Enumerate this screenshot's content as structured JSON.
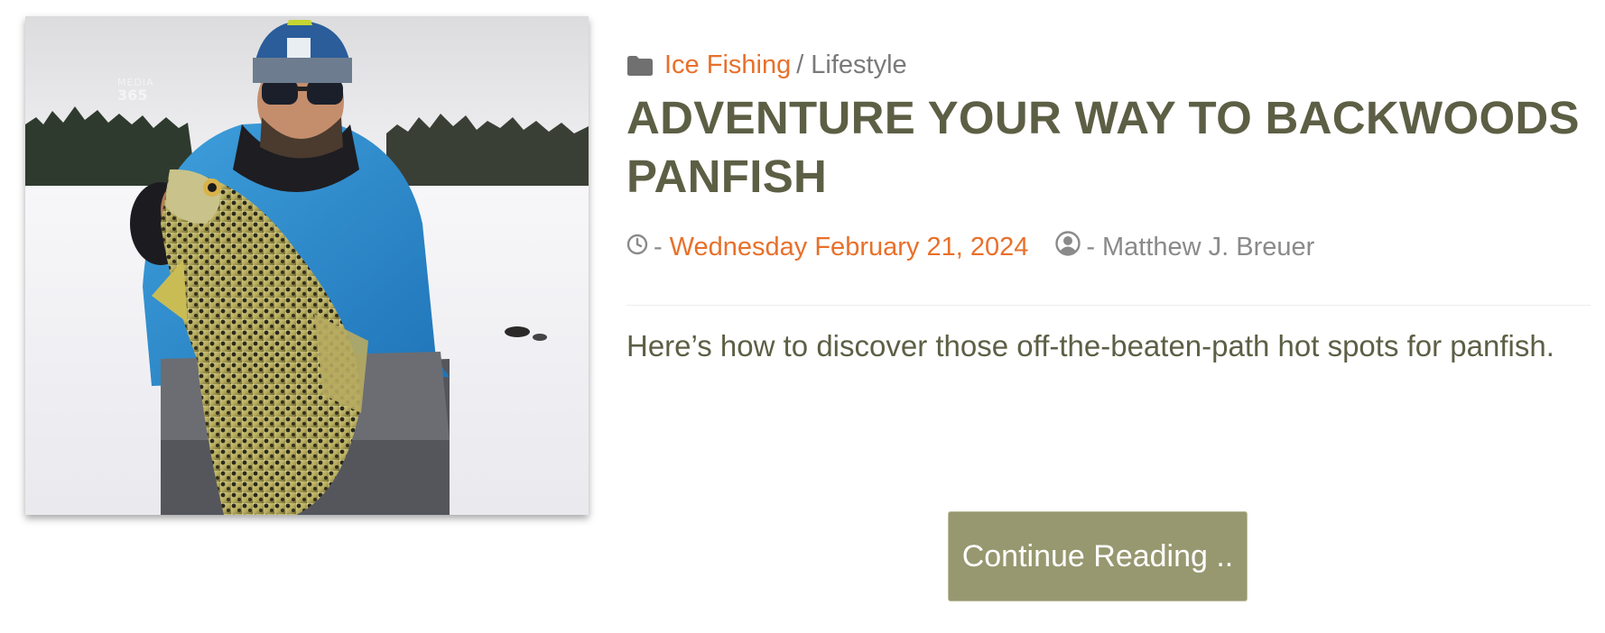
{
  "post": {
    "categories": {
      "icon": "folder-icon",
      "primary": "Ice Fishing",
      "separator": "/",
      "secondary": "Lifestyle"
    },
    "title": "ADVENTURE YOUR WAY TO BACKWOODS PANFISH",
    "meta": {
      "clock_icon": "clock-icon",
      "date_prefix": "-",
      "date": "Wednesday February 21, 2024",
      "author_icon": "user-circle-icon",
      "author_prefix": "-",
      "author": "Matthew J. Breuer"
    },
    "excerpt": "Here’s how to discover those off-the-beaten-path hot spots for panfish.",
    "continue_label": "Continue Reading ..",
    "image": {
      "watermark_top": "MEDIA",
      "watermark_bottom": "365"
    }
  },
  "colors": {
    "accent": "#e8702a",
    "title": "#5d5f45",
    "meta_gray": "#8a8a8a",
    "button_bg": "#979870",
    "button_text": "#ffffff"
  }
}
